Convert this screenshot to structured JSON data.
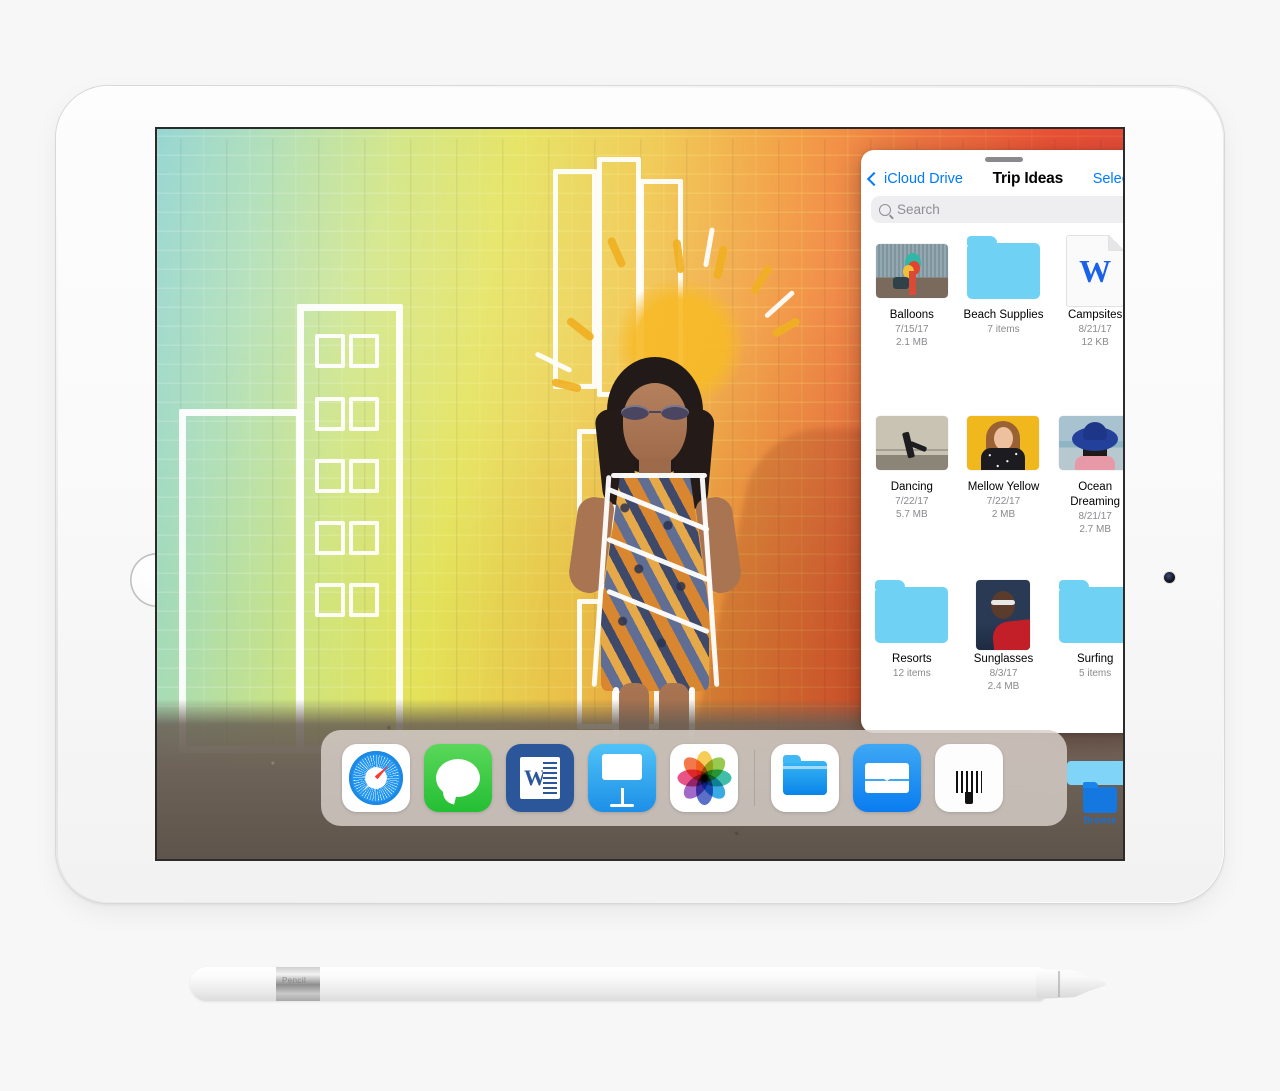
{
  "device": {
    "name": "iPad",
    "home_button": "home-button",
    "camera": "front-camera"
  },
  "files_panel": {
    "back_label": "iCloud Drive",
    "title": "Trip Ideas",
    "select_label": "Select",
    "search": {
      "placeholder": "Search",
      "value": ""
    },
    "items": [
      {
        "name": "Balloons",
        "kind": "photo",
        "date": "7/15/17",
        "size": "2.1 MB",
        "meta2": ""
      },
      {
        "name": "Beach Supplies",
        "kind": "folder",
        "date": "",
        "size": "",
        "meta2": "7 items"
      },
      {
        "name": "Campsites",
        "kind": "doc",
        "date": "8/21/17",
        "size": "12 KB",
        "meta2": "",
        "doc_glyph": "W"
      },
      {
        "name": "Dancing",
        "kind": "photo",
        "date": "7/22/17",
        "size": "5.7 MB",
        "meta2": ""
      },
      {
        "name": "Mellow Yellow",
        "kind": "photo",
        "date": "7/22/17",
        "size": "2 MB",
        "meta2": ""
      },
      {
        "name": "Ocean Dreaming",
        "kind": "photo",
        "date": "8/21/17",
        "size": "2.7 MB",
        "meta2": ""
      },
      {
        "name": "Resorts",
        "kind": "folder",
        "date": "",
        "size": "",
        "meta2": "12 items"
      },
      {
        "name": "Sunglasses",
        "kind": "photo",
        "date": "8/3/17",
        "size": "2.4 MB",
        "meta2": ""
      },
      {
        "name": "Surfing",
        "kind": "folder",
        "date": "",
        "size": "",
        "meta2": "5 items"
      }
    ]
  },
  "dock": {
    "apps": [
      {
        "label": "Safari",
        "icon": "safari-icon"
      },
      {
        "label": "Messages",
        "icon": "messages-icon"
      },
      {
        "label": "Word",
        "icon": "word-icon"
      },
      {
        "label": "Keynote",
        "icon": "keynote-icon"
      },
      {
        "label": "Photos",
        "icon": "photos-icon"
      },
      {
        "label": "Files",
        "icon": "files-icon"
      },
      {
        "label": "Mail",
        "icon": "mail-icon"
      },
      {
        "label": "Tool",
        "icon": "tool-icon"
      }
    ]
  },
  "home_screen": {
    "browse_folder_label": "Browse"
  },
  "accessories": {
    "pencil_label": "Pencil"
  },
  "colors": {
    "accent_blue": "#007aff",
    "folder_blue": "#6fd2f5",
    "dock_bg": "rgba(235,228,222,.70)",
    "secondary_text": "#8a8a8e",
    "page_bg": "#f7f7f7"
  }
}
